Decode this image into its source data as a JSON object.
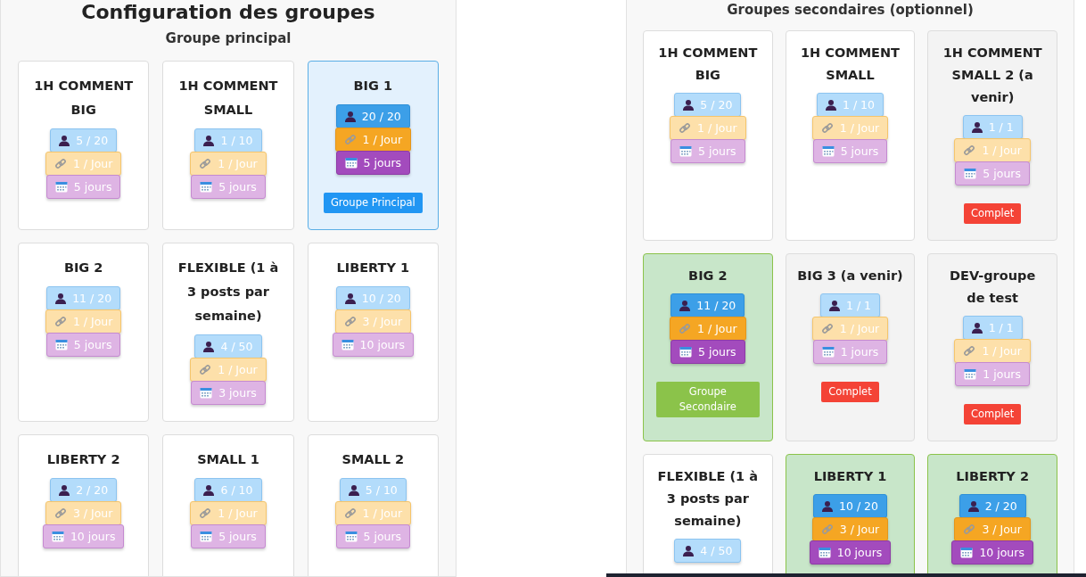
{
  "sections": [
    {
      "kind": "primary",
      "title": "Configuration des groupes",
      "subtitle": "Groupe principal",
      "cards": [
        {
          "name": "1H COMMENT BIG",
          "selected": false,
          "full": false,
          "chips": [
            {
              "kind": "members",
              "text": "5 / 20"
            },
            {
              "kind": "posts",
              "text": "1 / Jour"
            },
            {
              "kind": "days",
              "text": "5 jours"
            }
          ]
        },
        {
          "name": "1H COMMENT SMALL",
          "selected": false,
          "full": false,
          "chips": [
            {
              "kind": "members",
              "text": "1 / 10"
            },
            {
              "kind": "posts",
              "text": "1 / Jour"
            },
            {
              "kind": "days",
              "text": "5 jours"
            }
          ]
        },
        {
          "name": "BIG 1",
          "selected": true,
          "full": false,
          "tag": "Groupe Principal",
          "chips": [
            {
              "kind": "members",
              "text": "20 / 20"
            },
            {
              "kind": "posts",
              "text": "1 / Jour"
            },
            {
              "kind": "days",
              "text": "5 jours"
            }
          ]
        },
        {
          "name": "BIG 2",
          "selected": false,
          "full": false,
          "chips": [
            {
              "kind": "members",
              "text": "11 / 20"
            },
            {
              "kind": "posts",
              "text": "1 / Jour"
            },
            {
              "kind": "days",
              "text": "5 jours"
            }
          ]
        },
        {
          "name": "FLEXIBLE (1 à 3 posts par semaine)",
          "selected": false,
          "full": false,
          "chips": [
            {
              "kind": "members",
              "text": "4 / 50"
            },
            {
              "kind": "posts",
              "text": "1 / Jour"
            },
            {
              "kind": "days",
              "text": "3 jours"
            }
          ]
        },
        {
          "name": "LIBERTY 1",
          "selected": false,
          "full": false,
          "chips": [
            {
              "kind": "members",
              "text": "10 / 20"
            },
            {
              "kind": "posts",
              "text": "3 / Jour"
            },
            {
              "kind": "days",
              "text": "10 jours"
            }
          ]
        },
        {
          "name": "LIBERTY 2",
          "selected": false,
          "full": false,
          "chips": [
            {
              "kind": "members",
              "text": "2 / 20"
            },
            {
              "kind": "posts",
              "text": "3 / Jour"
            },
            {
              "kind": "days",
              "text": "10 jours"
            }
          ]
        },
        {
          "name": "SMALL 1",
          "selected": false,
          "full": false,
          "chips": [
            {
              "kind": "members",
              "text": "6 / 10"
            },
            {
              "kind": "posts",
              "text": "1 / Jour"
            },
            {
              "kind": "days",
              "text": "5 jours"
            }
          ]
        },
        {
          "name": "SMALL 2",
          "selected": false,
          "full": false,
          "chips": [
            {
              "kind": "members",
              "text": "5 / 10"
            },
            {
              "kind": "posts",
              "text": "1 / Jour"
            },
            {
              "kind": "days",
              "text": "5 jours"
            }
          ]
        }
      ]
    },
    {
      "kind": "secondary",
      "subtitle": "Groupes secondaires (optionnel)",
      "cards": [
        {
          "name": "1H COMMENT BIG",
          "selected": false,
          "full": false,
          "chips": [
            {
              "kind": "members",
              "text": "5 / 20"
            },
            {
              "kind": "posts",
              "text": "1 / Jour"
            },
            {
              "kind": "days",
              "text": "5 jours"
            }
          ]
        },
        {
          "name": "1H COMMENT SMALL",
          "selected": false,
          "full": false,
          "chips": [
            {
              "kind": "members",
              "text": "1 / 10"
            },
            {
              "kind": "posts",
              "text": "1 / Jour"
            },
            {
              "kind": "days",
              "text": "5 jours"
            }
          ]
        },
        {
          "name": "1H COMMENT SMALL 2 (a venir)",
          "selected": false,
          "full": true,
          "tag": "Complet",
          "chips": [
            {
              "kind": "members",
              "text": "1 / 1"
            },
            {
              "kind": "posts",
              "text": "1 / Jour"
            },
            {
              "kind": "days",
              "text": "5 jours"
            }
          ]
        },
        {
          "name": "BIG 2",
          "selected": true,
          "full": false,
          "tag": "Groupe Secondaire",
          "chips": [
            {
              "kind": "members",
              "text": "11 / 20"
            },
            {
              "kind": "posts",
              "text": "1 / Jour"
            },
            {
              "kind": "days",
              "text": "5 jours"
            }
          ]
        },
        {
          "name": "BIG 3 (a venir)",
          "selected": false,
          "full": true,
          "tag": "Complet",
          "chips": [
            {
              "kind": "members",
              "text": "1 / 1"
            },
            {
              "kind": "posts",
              "text": "1 / Jour"
            },
            {
              "kind": "days",
              "text": "1 jours"
            }
          ]
        },
        {
          "name": "DEV-groupe de test",
          "selected": false,
          "full": true,
          "tag": "Complet",
          "chips": [
            {
              "kind": "members",
              "text": "1 / 1"
            },
            {
              "kind": "posts",
              "text": "1 / Jour"
            },
            {
              "kind": "days",
              "text": "1 jours"
            }
          ]
        },
        {
          "name": "FLEXIBLE (1 à 3 posts par semaine)",
          "selected": false,
          "full": false,
          "chips": [
            {
              "kind": "members",
              "text": "4 / 50"
            }
          ]
        },
        {
          "name": "LIBERTY 1",
          "selected": true,
          "full": false,
          "chips": [
            {
              "kind": "members",
              "text": "10 / 20"
            },
            {
              "kind": "posts",
              "text": "3 / Jour"
            },
            {
              "kind": "days",
              "text": "10 jours"
            }
          ]
        },
        {
          "name": "LIBERTY 2",
          "selected": true,
          "full": false,
          "chips": [
            {
              "kind": "members",
              "text": "2 / 20"
            },
            {
              "kind": "posts",
              "text": "3 / Jour"
            },
            {
              "kind": "days",
              "text": "10 jours"
            }
          ]
        }
      ]
    }
  ]
}
